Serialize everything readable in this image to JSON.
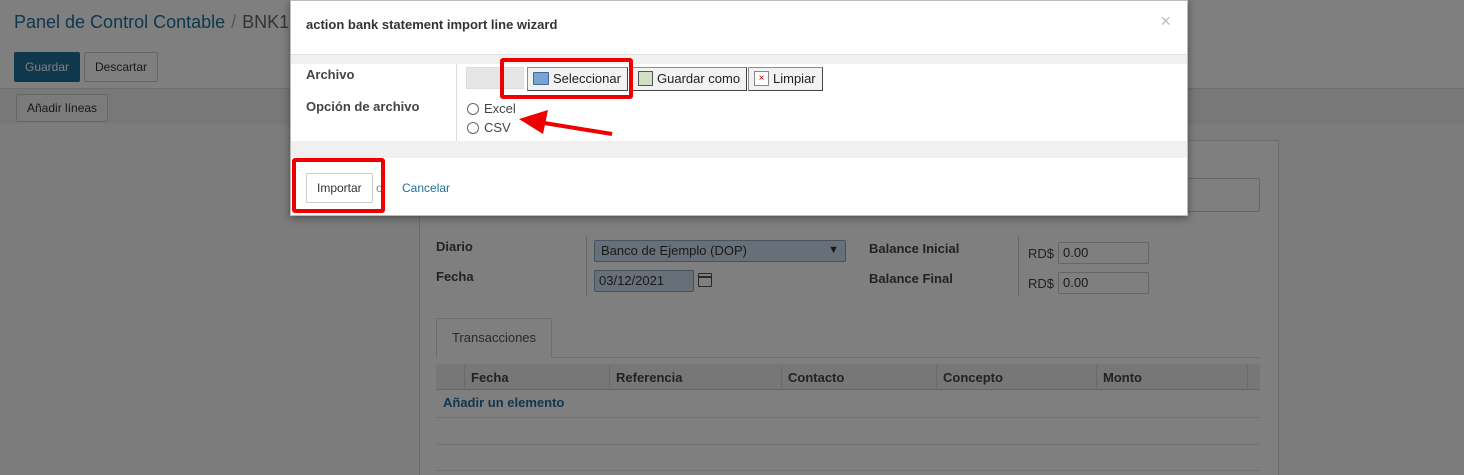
{
  "background": {
    "breadcrumb": {
      "parent": "Panel de Control Contable",
      "separator": "/",
      "current": "BNK1"
    },
    "buttons": {
      "save": "Guardar",
      "discard": "Descartar",
      "add_lines": "Añadir líneas"
    },
    "form": {
      "journal_label": "Diario",
      "journal_value": "Banco de Ejemplo (DOP)",
      "date_label": "Fecha",
      "date_value": "03/12/2021",
      "start_balance_label": "Balance Inicial",
      "end_balance_label": "Balance Final",
      "currency": "RD$",
      "start_balance_value": "0.00",
      "end_balance_value": "0.00"
    },
    "tab_transactions": "Transacciones",
    "table": {
      "columns": [
        "Fecha",
        "Referencia",
        "Contacto",
        "Concepto",
        "Monto"
      ],
      "add_item": "Añadir un elemento"
    }
  },
  "modal": {
    "title": "action bank statement import line wizard",
    "close_glyph": "×",
    "file_label": "Archivo",
    "file_option_label": "Opción de archivo",
    "select_button": "Seleccionar",
    "save_as_button": "Guardar como",
    "clear_button": "Limpiar",
    "clear_glyph": "×",
    "radio_options": [
      "Excel",
      "CSV"
    ],
    "import_button": "Importar",
    "or_text": "o",
    "cancel_link": "Cancelar"
  },
  "colors": {
    "primary": "#1f6f9c",
    "annotation_red": "#ee0000",
    "overlay": "rgba(0,0,0,0.5)"
  }
}
